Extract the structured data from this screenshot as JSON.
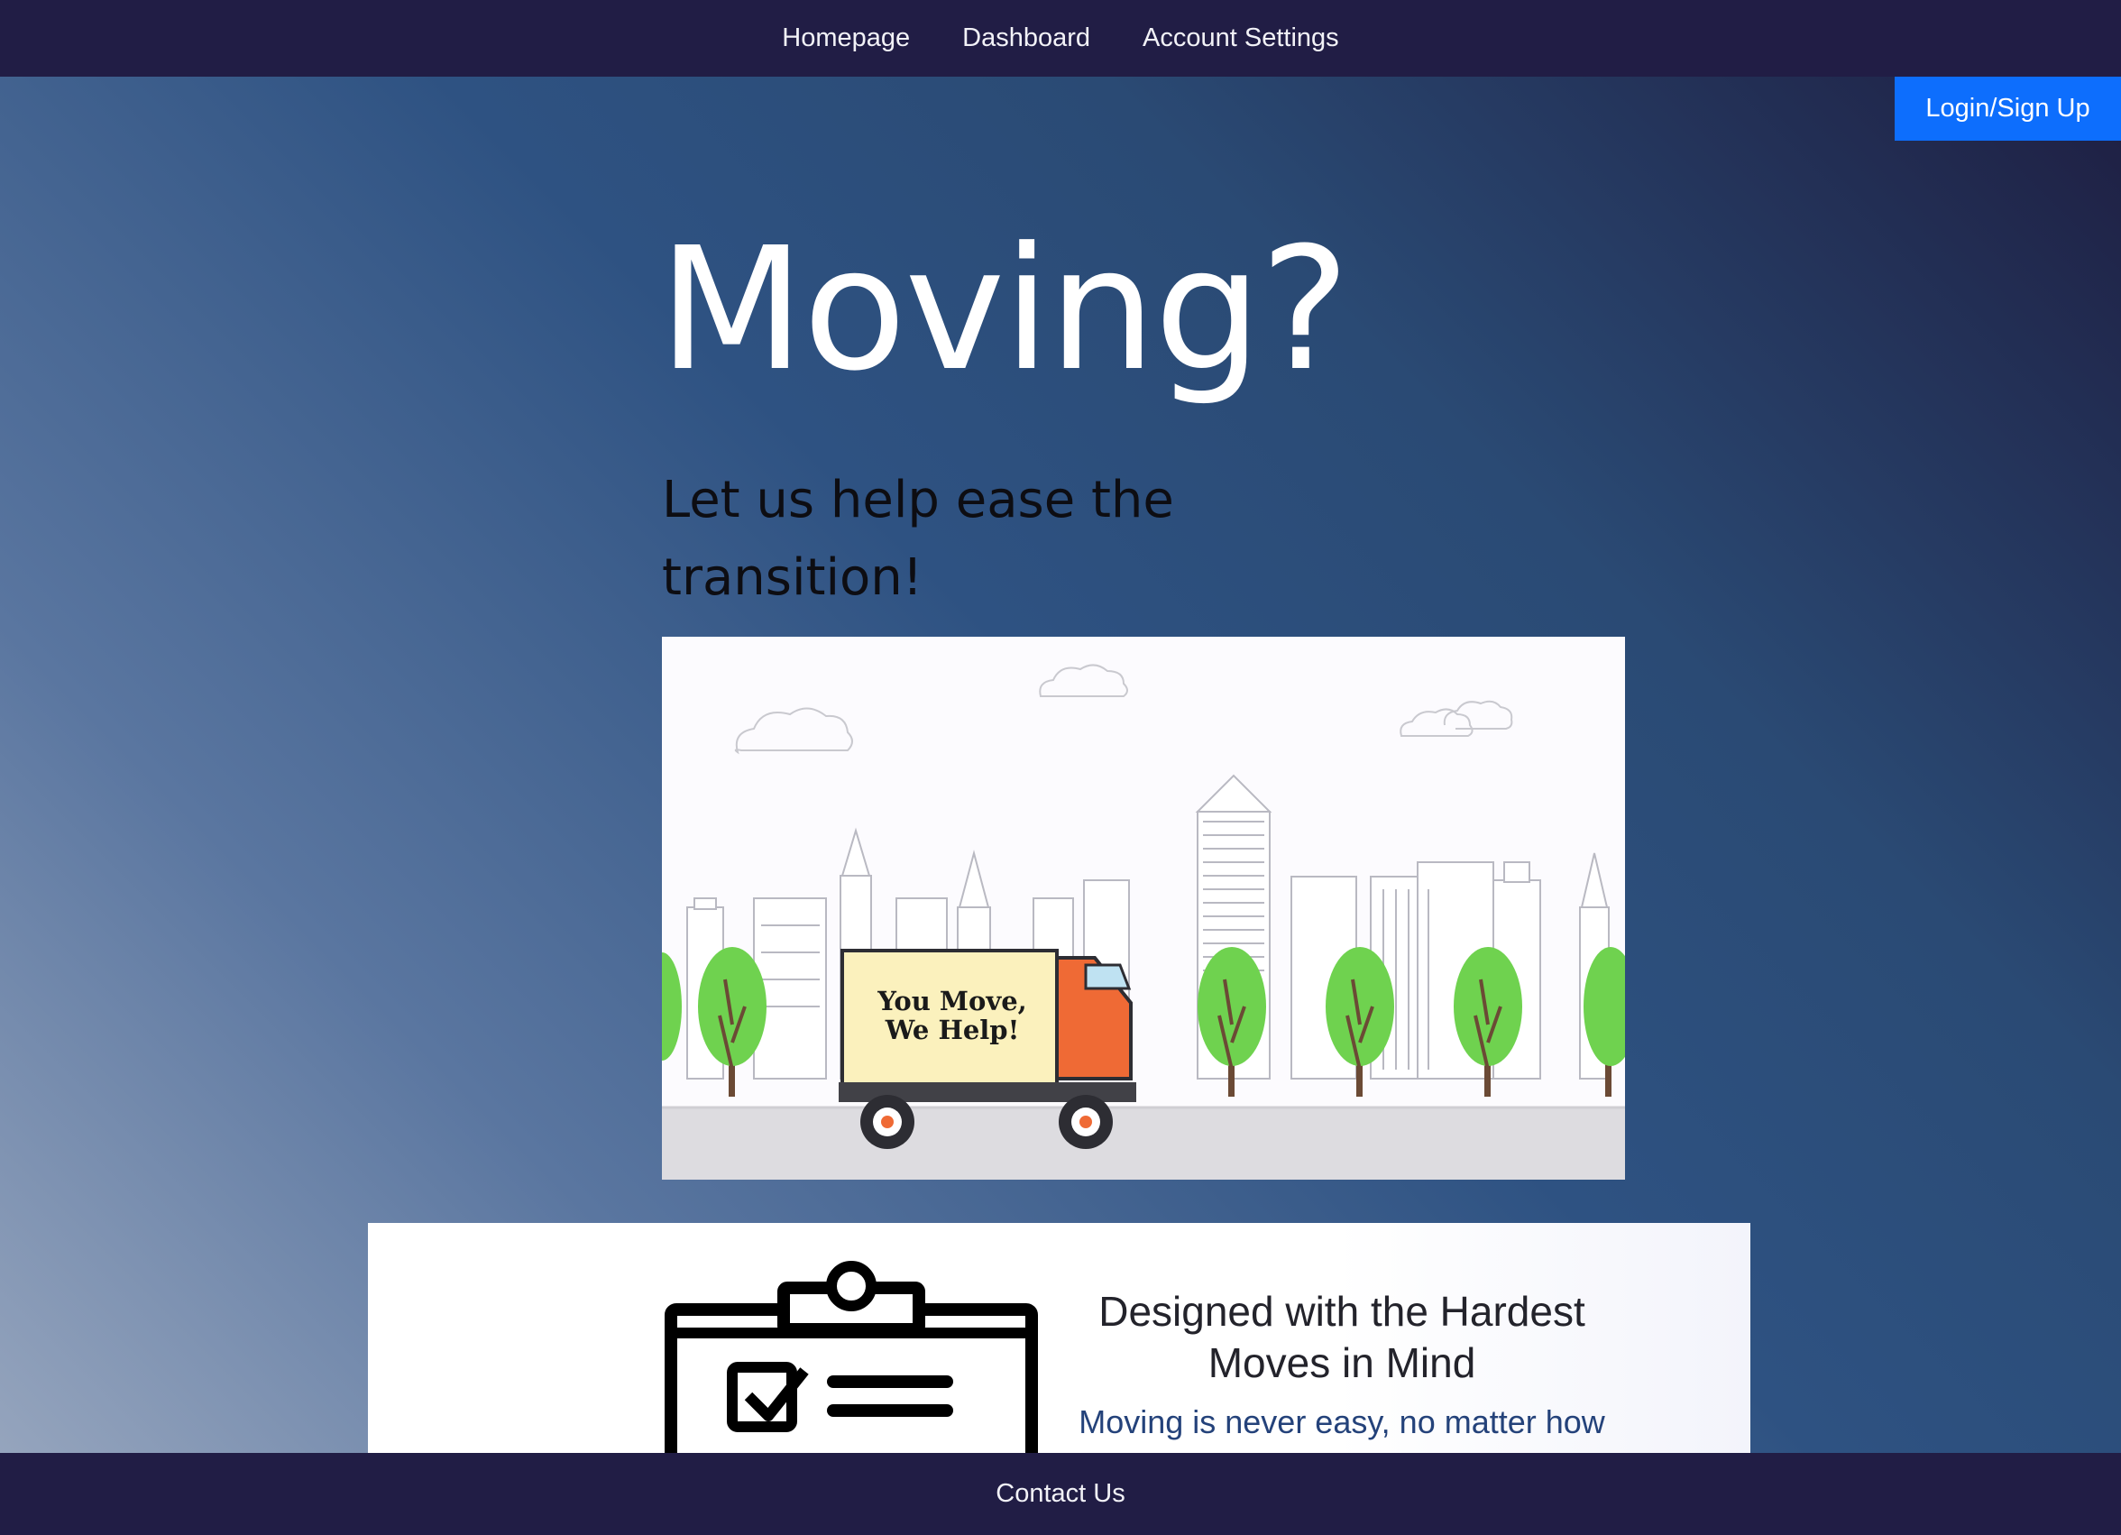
{
  "nav": {
    "items": [
      {
        "label": "Homepage"
      },
      {
        "label": "Dashboard"
      },
      {
        "label": "Account Settings"
      }
    ],
    "login_label": "Login/Sign Up"
  },
  "hero": {
    "title": "Moving?",
    "subtitle": "Let us help ease the transition!",
    "image": {
      "truck_text_line1": "You Move,",
      "truck_text_line2": "We Help!"
    }
  },
  "feature": {
    "icon": "clipboard-checklist-icon",
    "heading": "Designed with the Hardest Moves in Mind",
    "text": "Moving is never easy, no matter how"
  },
  "footer": {
    "contact_label": "Contact Us"
  },
  "colors": {
    "nav_bg": "#211d45",
    "login_bg": "#0d6efd",
    "feature_text": "#24427a"
  }
}
